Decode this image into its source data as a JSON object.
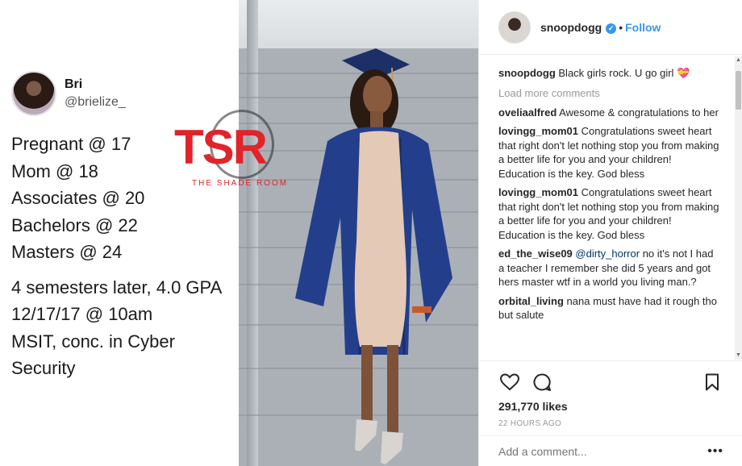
{
  "tweet": {
    "name": "Bri",
    "handle": "@brielize_",
    "lines": [
      "Pregnant @ 17",
      "Mom @ 18",
      "Associates @ 20",
      "Bachelors @ 22",
      "Masters @ 24"
    ],
    "lines2": [
      "4 semesters later, 4.0 GPA",
      "12/17/17 @ 10am",
      "MSIT, conc. in Cyber Security"
    ]
  },
  "watermark": {
    "letters": "TSR",
    "subtitle": "THE SHADE ROOM"
  },
  "post": {
    "username": "snoopdogg",
    "follow_label": "Follow",
    "dot": "•",
    "caption_user": "snoopdogg",
    "caption_text": "Black girls rock. U go girl 💝",
    "load_more": "Load more comments",
    "comments": [
      {
        "user": "oveliaalfred",
        "text": "Awesome & congratulations to her"
      },
      {
        "user": "lovingg_mom01",
        "text": "Congratulations sweet heart that right don't let nothing stop you from making a better life for you and your children! Education is the key. God bless"
      },
      {
        "user": "lovingg_mom01",
        "text": "Congratulations sweet heart that right don't let nothing stop you from making a better life for you and your children! Education is the key. God bless"
      },
      {
        "user": "ed_the_wise09",
        "mention": "@dirty_horror",
        "text": "no it's not I had a teacher I remember she did 5 years and got hers master wtf in a world you living man.?"
      },
      {
        "user": "orbital_living",
        "text": "nana must have had it rough tho but salute"
      }
    ],
    "likes": "291,770 likes",
    "time": "22 HOURS AGO",
    "add_comment_placeholder": "Add a comment...",
    "more_label": "•••"
  },
  "icons": [
    "heart-icon",
    "comment-icon",
    "bookmark-icon",
    "verified-icon"
  ],
  "colors": {
    "accent": "#3897f0",
    "watermark_red": "#e0242a",
    "gown_blue": "#1f3f8f"
  }
}
